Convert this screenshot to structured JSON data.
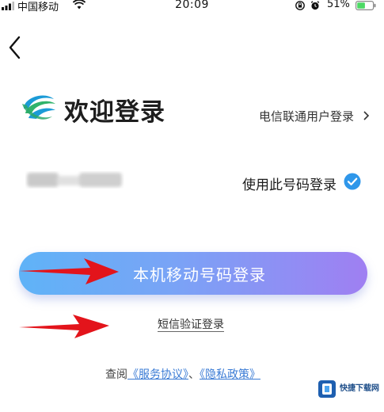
{
  "status_bar": {
    "carrier": "中国移动",
    "time": "20:09",
    "battery_percent": "51%",
    "battery_level": 0.51
  },
  "header": {
    "welcome_title": "欢迎登录",
    "telecom_link": "电信联通用户登录"
  },
  "phone_row": {
    "use_number_label": "使用此号码登录",
    "selected": true
  },
  "actions": {
    "primary_login": "本机移动号码登录",
    "sms_login": "短信验证登录"
  },
  "agreement": {
    "prefix": "查阅",
    "service_link": "《服务协议》",
    "separator": "、",
    "privacy_link": "《隐私政策》"
  },
  "watermark": {
    "brand": "快捷下载网"
  },
  "colors": {
    "accent_blue": "#3a8ee6",
    "button_start": "#5fb3f7",
    "button_end": "#9f7ff2",
    "annotation_arrow": "#e3141b"
  },
  "icons": [
    "back-icon",
    "logo-icon",
    "chevron-right-icon",
    "check-icon",
    "wifi-icon",
    "signal-icon",
    "lock-icon",
    "alarm-icon",
    "battery-icon"
  ]
}
